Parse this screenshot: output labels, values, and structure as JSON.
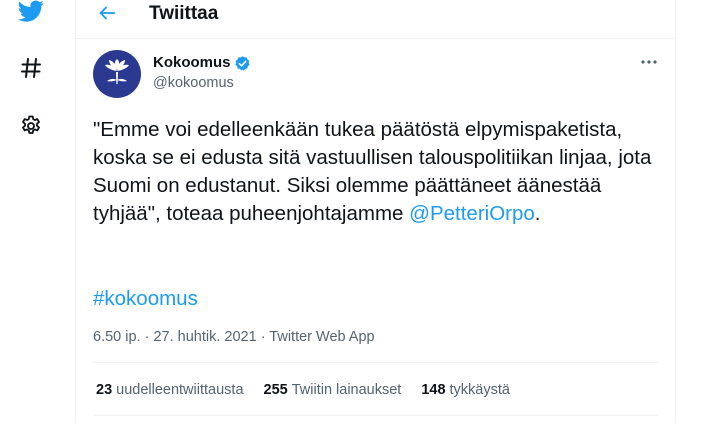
{
  "colors": {
    "accent": "#1d9bf0",
    "text": "#0f1419",
    "muted": "#536471",
    "avatar_bg": "#2b3991"
  },
  "sidebar": {
    "icons": [
      "twitter-bird-icon",
      "hashtag-icon",
      "gear-icon"
    ]
  },
  "header": {
    "title": "Twiittaa",
    "back_icon": "arrow-left-icon"
  },
  "tweet": {
    "author_name": "Kokoomus",
    "author_handle": "@kokoomus",
    "text_before_mention": "\"Emme voi edelleenkään tukea päätöstä elpymispaketista, koska se ei edusta sitä vastuullisen talouspolitiikan linjaa, jota Suomi on edustanut. Siksi olemme päättäneet äänestää tyhjää\", toteaa puheenjohtajamme ",
    "mention": "@PetteriOrpo",
    "text_after_mention": ".",
    "hashtag": "#kokoomus",
    "time": "6.50 ip.",
    "date": "27. huhtik. 2021",
    "separator": " · ",
    "source": "Twitter Web App"
  },
  "stats": {
    "retweets_count": "23",
    "retweets_label": "uudelleentwiittausta",
    "quotes_count": "255",
    "quotes_label": "Twiitin lainaukset",
    "likes_count": "148",
    "likes_label": "tykkäystä"
  }
}
